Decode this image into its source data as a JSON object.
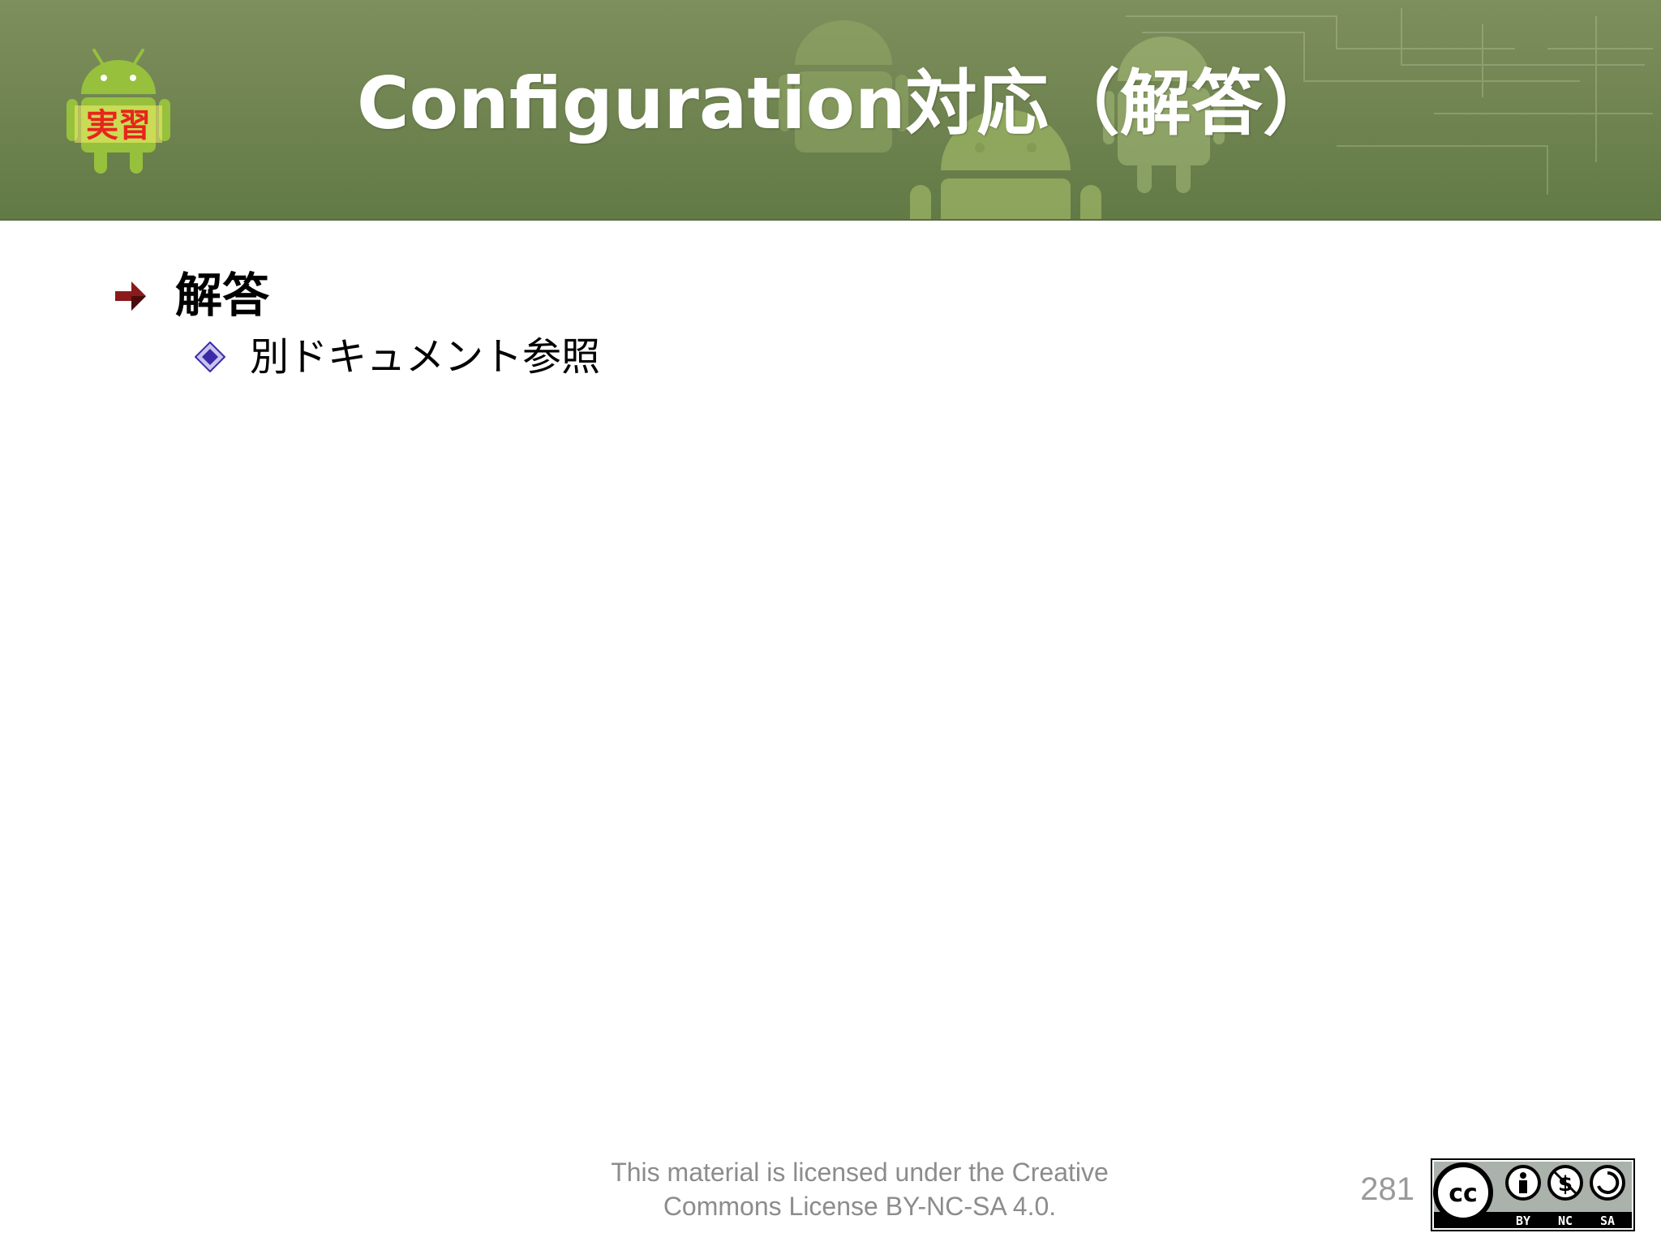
{
  "slide": {
    "title": "Configuration対応（解答）",
    "logo_label": "実習",
    "bullets": [
      {
        "text": "解答",
        "sub": [
          {
            "text": "別ドキュメント参照"
          }
        ]
      }
    ]
  },
  "footer": {
    "license_line1": "This material is licensed under the Creative",
    "license_line2": "Commons License BY-NC-SA 4.0.",
    "page_number": "281",
    "cc_badge": {
      "by": "BY",
      "nc": "NC",
      "sa": "SA"
    }
  },
  "colors": {
    "header_green": "#6f8350",
    "android_green": "#97c03d",
    "logo_text_red": "#e8241c",
    "bullet_l1": "#8b1a1a",
    "bullet_l2": "#3a2aa8",
    "footer_gray": "#8c8c8c"
  },
  "icons": {
    "logo": "android-robot-icon",
    "bullet_l1": "arrow-down-right-icon",
    "bullet_l2": "diamond-icon",
    "license": "creative-commons-icon"
  }
}
